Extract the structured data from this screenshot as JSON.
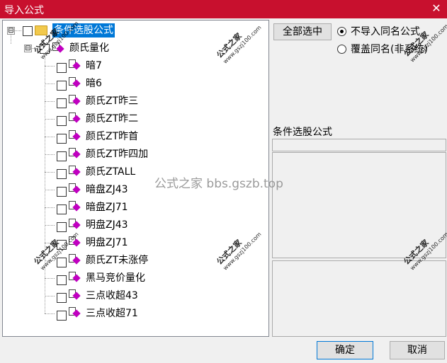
{
  "window": {
    "title": "导入公式",
    "close_glyph": "✕"
  },
  "tree": {
    "root_expander": "⊟",
    "root_label": "条件选股公式",
    "group_expander": "⊟",
    "group_label": "颜氏量化",
    "items": [
      "暗7",
      "暗6",
      "颜氏ZT昨三",
      "颜氏ZT昨二",
      "颜氏ZT昨首",
      "颜氏ZT昨四加",
      "颜氏ZTALL",
      "暗盘ZJ43",
      "暗盘ZJ71",
      "明盘ZJ43",
      "明盘ZJ71",
      "颜氏ZT未涨停",
      "黑马竞价量化",
      "三点收超43",
      "三点收超71"
    ]
  },
  "options": {
    "select_all_label": "全部选中",
    "radio1_label": "不导入同名公式",
    "radio2_label": "覆盖同名(非系统)",
    "selected_radio": 1
  },
  "info": {
    "category_label": "条件选股公式"
  },
  "footer": {
    "ok_label": "确定",
    "cancel_label": "取消"
  },
  "watermark": {
    "cn": "公式之家",
    "url": "www.gszj100.com",
    "center": "公式之家 bbs.gszb.top"
  }
}
